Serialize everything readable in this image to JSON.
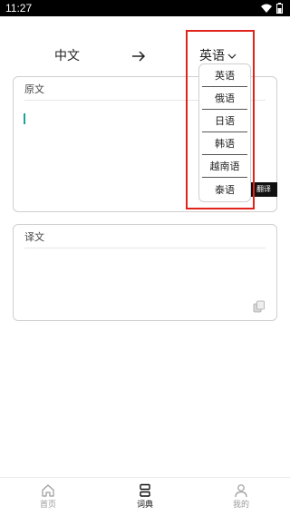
{
  "status_bar": {
    "time": "11:27",
    "icons": [
      "wifi-icon",
      "battery-icon"
    ]
  },
  "language_bar": {
    "source_language": "中文",
    "arrow_icon": "arrow-right-icon",
    "target_language": "英语",
    "dropdown_icon": "chevron-down-icon"
  },
  "language_dropdown": {
    "options": [
      "英语",
      "俄语",
      "日语",
      "韩语",
      "越南语",
      "泰语"
    ],
    "highlight_color": "#e0241b"
  },
  "source_panel": {
    "label": "原文",
    "value": "",
    "caret_color": "#1aa39a"
  },
  "translate_button": {
    "label": "翻译"
  },
  "result_panel": {
    "label": "译文",
    "value": "",
    "copy_icon": "copy-icon"
  },
  "bottom_nav": {
    "items": [
      {
        "label": "首页",
        "icon": "home-icon",
        "active": false
      },
      {
        "label": "词典",
        "icon": "dictionary-icon",
        "active": true
      },
      {
        "label": "我的",
        "icon": "profile-icon",
        "active": false
      }
    ]
  }
}
